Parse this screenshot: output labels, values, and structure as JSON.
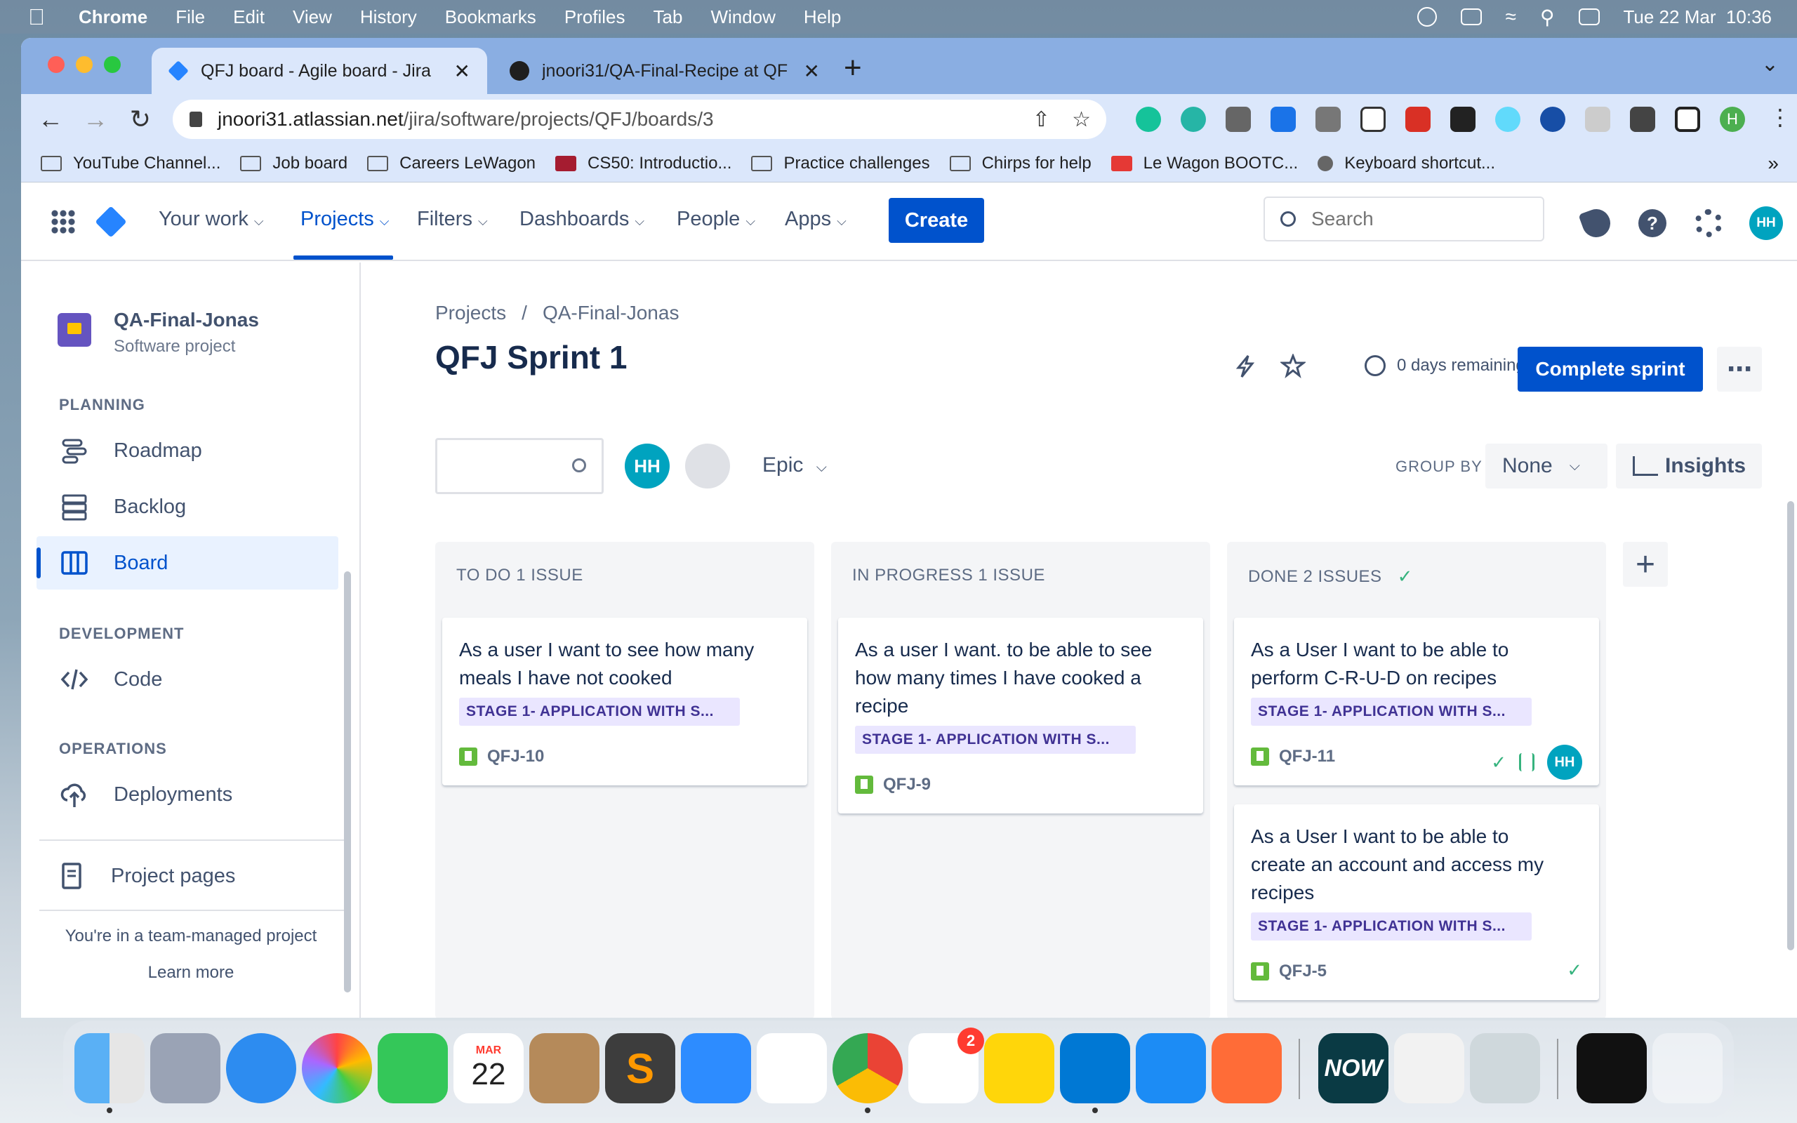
{
  "menubar": {
    "app": "Chrome",
    "items": [
      "File",
      "Edit",
      "View",
      "History",
      "Bookmarks",
      "Profiles",
      "Tab",
      "Window",
      "Help"
    ],
    "clock": "Tue 22 Mar  10:36"
  },
  "browser": {
    "tabs": [
      {
        "title": "QFJ board - Agile board - Jira",
        "active": true
      },
      {
        "title": "jnoori31/QA-Final-Recipe at QF",
        "active": false
      }
    ],
    "url_host": "jnoori31.atlassian.net",
    "url_path": "/jira/software/projects/QFJ/boards/3",
    "profile_initial": "H",
    "bookmarks": [
      "YouTube Channel...",
      "Job board",
      "Careers LeWagon",
      "CS50: Introductio...",
      "Practice challenges",
      "Chirps for help",
      "Le Wagon BOOTC...",
      "Keyboard shortcut..."
    ]
  },
  "topnav": {
    "items": [
      "Your work",
      "Projects",
      "Filters",
      "Dashboards",
      "People",
      "Apps"
    ],
    "active": "Projects",
    "create_label": "Create",
    "search_placeholder": "Search",
    "user_initials": "HH"
  },
  "sidebar": {
    "project_name": "QA-Final-Jonas",
    "project_type": "Software project",
    "planning_heading": "PLANNING",
    "planning_items": [
      "Roadmap",
      "Backlog",
      "Board"
    ],
    "development_heading": "DEVELOPMENT",
    "development_items": [
      "Code"
    ],
    "operations_heading": "OPERATIONS",
    "operations_items": [
      "Deployments"
    ],
    "project_pages": "Project pages",
    "footer_text": "You're in a team-managed project",
    "learn_more": "Learn more"
  },
  "board": {
    "breadcrumb": [
      "Projects",
      "QA-Final-Jonas"
    ],
    "breadcrumb_sep": "/",
    "sprint_title": "QFJ Sprint 1",
    "days_remaining": "0 days remaining",
    "complete_sprint": "Complete sprint",
    "filter_avatar": "HH",
    "epic_filter": "Epic",
    "group_by_label": "GROUP BY",
    "group_by_value": "None",
    "insights": "Insights",
    "columns": [
      {
        "title": "TO DO 1 ISSUE",
        "done_check": false,
        "cards": [
          {
            "summary": "As a user I want to see how many meals I have not cooked",
            "epic": "STAGE 1- APPLICATION WITH S...",
            "key": "QFJ-10"
          }
        ]
      },
      {
        "title": "IN PROGRESS 1 ISSUE",
        "done_check": false,
        "cards": [
          {
            "summary": "As a user I want. to be able to see how many times I have cooked a recipe",
            "epic": "STAGE 1- APPLICATION WITH S...",
            "key": "QFJ-9"
          }
        ]
      },
      {
        "title": "DONE 2 ISSUES",
        "done_check": true,
        "cards": [
          {
            "summary": "As a User I want to be able to perform C-R-U-D on recipes",
            "epic": "STAGE 1- APPLICATION WITH S...",
            "key": "QFJ-11",
            "assignee": "HH"
          },
          {
            "summary": "As a User I want to be able to create an account and access my recipes",
            "epic": "STAGE 1- APPLICATION WITH S...",
            "key": "QFJ-5"
          }
        ]
      }
    ]
  },
  "dock": {
    "calendar_month": "MAR",
    "calendar_day": "22",
    "reminders_badge": "2",
    "now_label": "NOW"
  },
  "colors": {
    "jira_blue": "#0052cc",
    "epic_bg": "#eae6ff",
    "epic_text": "#403294",
    "done_green": "#36b37e",
    "avatar_teal": "#00a3bf"
  }
}
